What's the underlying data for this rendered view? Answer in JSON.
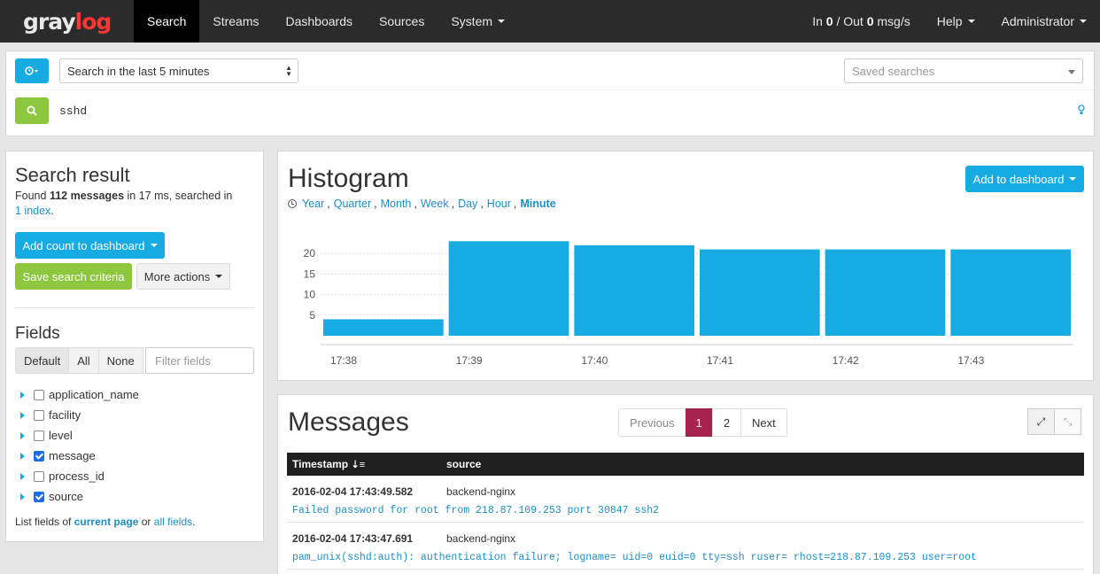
{
  "navbar": {
    "brand_part1": "gray",
    "brand_part2": "log",
    "items": [
      "Search",
      "Streams",
      "Dashboards",
      "Sources",
      "System"
    ],
    "throughput_in_label": "In",
    "throughput_in": "0",
    "throughput_sep": "/ Out",
    "throughput_out": "0",
    "throughput_unit": "msg/s",
    "help": "Help",
    "user": "Administrator"
  },
  "search": {
    "range": "Search in the last 5 minutes",
    "saved_placeholder": "Saved searches",
    "query": "sshd"
  },
  "sidebar": {
    "title": "Search result",
    "found_prefix": "Found",
    "found_count": "112 messages",
    "found_mid": "in 17 ms, searched in",
    "index_link": "1 index",
    "found_end": ".",
    "add_count_button": "Add count to dashboard",
    "save_button": "Save search criteria",
    "more_actions": "More actions",
    "fields_title": "Fields",
    "filter_tabs": [
      "Default",
      "All",
      "None"
    ],
    "filter_placeholder": "Filter fields",
    "fields": [
      {
        "name": "application_name",
        "checked": false
      },
      {
        "name": "facility",
        "checked": false
      },
      {
        "name": "level",
        "checked": false
      },
      {
        "name": "message",
        "checked": true
      },
      {
        "name": "process_id",
        "checked": false
      },
      {
        "name": "source",
        "checked": true
      }
    ],
    "list_prefix": "List fields of",
    "list_current": "current page",
    "list_or": "or",
    "list_all": "all fields",
    "list_end": "."
  },
  "histogram": {
    "title": "Histogram",
    "add_button": "Add to dashboard",
    "resolutions": [
      "Year",
      "Quarter",
      "Month",
      "Week",
      "Day",
      "Hour",
      "Minute"
    ],
    "active_resolution": "Minute"
  },
  "chart_data": {
    "type": "bar",
    "categories": [
      "17:38",
      "17:39",
      "17:40",
      "17:41",
      "17:42",
      "17:43"
    ],
    "values": [
      4,
      23,
      22,
      21,
      21,
      21
    ],
    "yticks": [
      5,
      10,
      15,
      20
    ],
    "ylim": [
      0,
      25
    ],
    "color": "#16ace3",
    "grid": true
  },
  "messages": {
    "title": "Messages",
    "pager": {
      "prev": "Previous",
      "pages": [
        "1",
        "2"
      ],
      "current": "1",
      "next": "Next"
    },
    "columns": [
      "Timestamp",
      "source"
    ],
    "rows": [
      {
        "timestamp": "2016-02-04 17:43:49.582",
        "source": "backend-nginx",
        "message": "Failed password for root from 218.87.109.253 port 30847 ssh2"
      },
      {
        "timestamp": "2016-02-04 17:43:47.691",
        "source": "backend-nginx",
        "message": "pam_unix(sshd:auth): authentication failure; logname= uid=0 euid=0 tty=ssh ruser= rhost=218.87.109.253 user=root"
      }
    ]
  }
}
